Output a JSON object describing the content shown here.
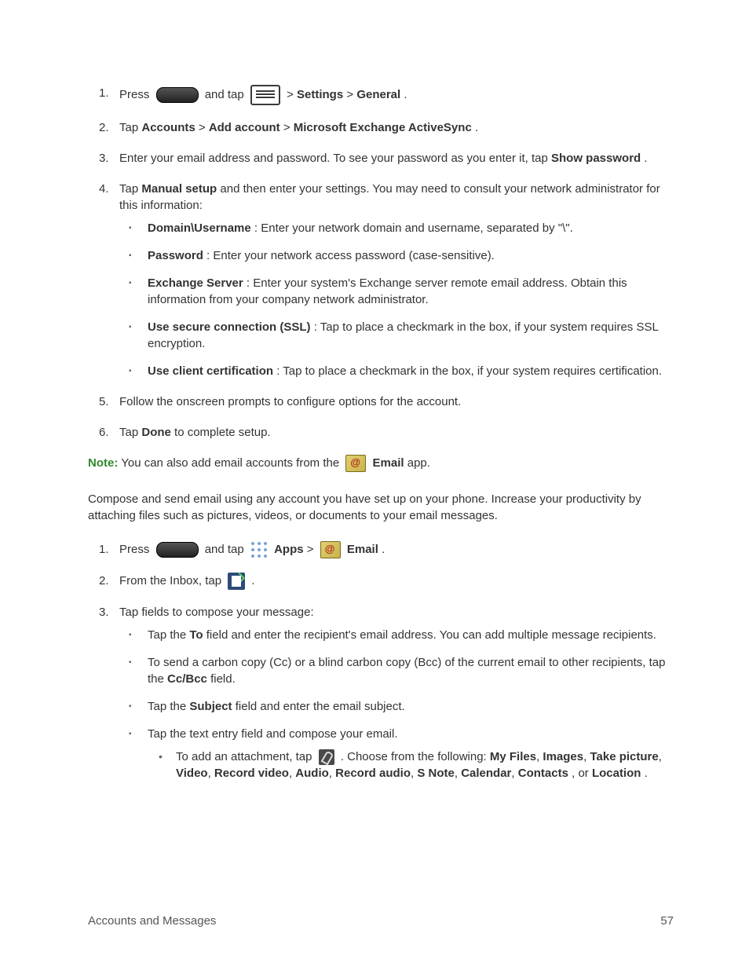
{
  "footer": {
    "section": "Accounts and Messages",
    "page": "57"
  },
  "section1": {
    "steps": [
      {
        "n": "1.",
        "pre": "Press ",
        "mid": " and tap ",
        "post": " > ",
        "b1": "Settings",
        "gt1": " > ",
        "b2": "General",
        "end": "."
      },
      {
        "n": "2.",
        "pre": "Tap ",
        "b1": "Accounts",
        "gt1": " > ",
        "b2": "Add account",
        "gt2": " > ",
        "b3": "Microsoft Exchange ActiveSync",
        "end": "."
      },
      {
        "n": "3.",
        "text": "Enter your email address and password. To see your password as you enter it, tap ",
        "b1": "Show password",
        "end": "."
      },
      {
        "n": "4.",
        "pre": "Tap ",
        "b1": "Manual setup",
        "post": " and then enter your settings. You may need to consult your network administrator for this information:",
        "sub": [
          {
            "b": "Domain\\Username",
            "t": ": Enter your network domain and username, separated by \"\\\"."
          },
          {
            "b": "Password",
            "t": ": Enter your network access password (case-sensitive)."
          },
          {
            "b": "Exchange Server",
            "t": ": Enter your system's Exchange server remote email address. Obtain this information from your company network administrator."
          },
          {
            "b": "Use secure connection (SSL)",
            "t": ": Tap to place a checkmark in the box, if your system requires SSL encryption."
          },
          {
            "b": "Use client certification",
            "t": ": Tap to place a checkmark in the box, if your system requires certification."
          }
        ]
      },
      {
        "n": "5.",
        "text": "Follow the onscreen prompts to configure options for the account."
      },
      {
        "n": "6.",
        "pre": "Tap ",
        "b1": "Done",
        "post": " to complete setup."
      }
    ],
    "note": {
      "label": "Note:",
      "pre": " You can also add email accounts from the ",
      "b": "Email",
      "post": " app."
    }
  },
  "section2": {
    "intro": "Compose and send email using any account you have set up on your phone. Increase your productivity by attaching files such as pictures, videos, or documents to your email messages.",
    "steps": [
      {
        "n": "1.",
        "pre": "Press ",
        "mid": " and tap ",
        "b1": "Apps",
        "gt1": " > ",
        "b2": "Email",
        "end": "."
      },
      {
        "n": "2.",
        "pre": "From the Inbox, tap ",
        "end": "."
      },
      {
        "n": "3.",
        "text": "Tap fields to compose your message:",
        "sub": [
          {
            "pre": "Tap the ",
            "b": "To",
            "post": " field and enter the recipient's email address. You can add multiple message recipients."
          },
          {
            "pre": "To send a carbon copy (Cc) or a blind carbon copy (Bcc) of the current email to other recipients, tap the ",
            "b": "Cc/Bcc",
            "post": " field."
          },
          {
            "pre": "Tap the ",
            "b": "Subject",
            "post": " field and enter the email subject."
          },
          {
            "text": "Tap the text entry field and compose your email.",
            "bullet": {
              "pre": "To add an attachment, tap ",
              "post": ". Choose from the following: ",
              "opts": [
                "My Files",
                "Images",
                "Take picture",
                "Video",
                "Record video",
                "Audio",
                "Record audio",
                "S Note",
                "Calendar",
                "Contacts"
              ],
              "or": ", or ",
              "last": "Location",
              "end": "."
            }
          }
        ]
      }
    ]
  }
}
